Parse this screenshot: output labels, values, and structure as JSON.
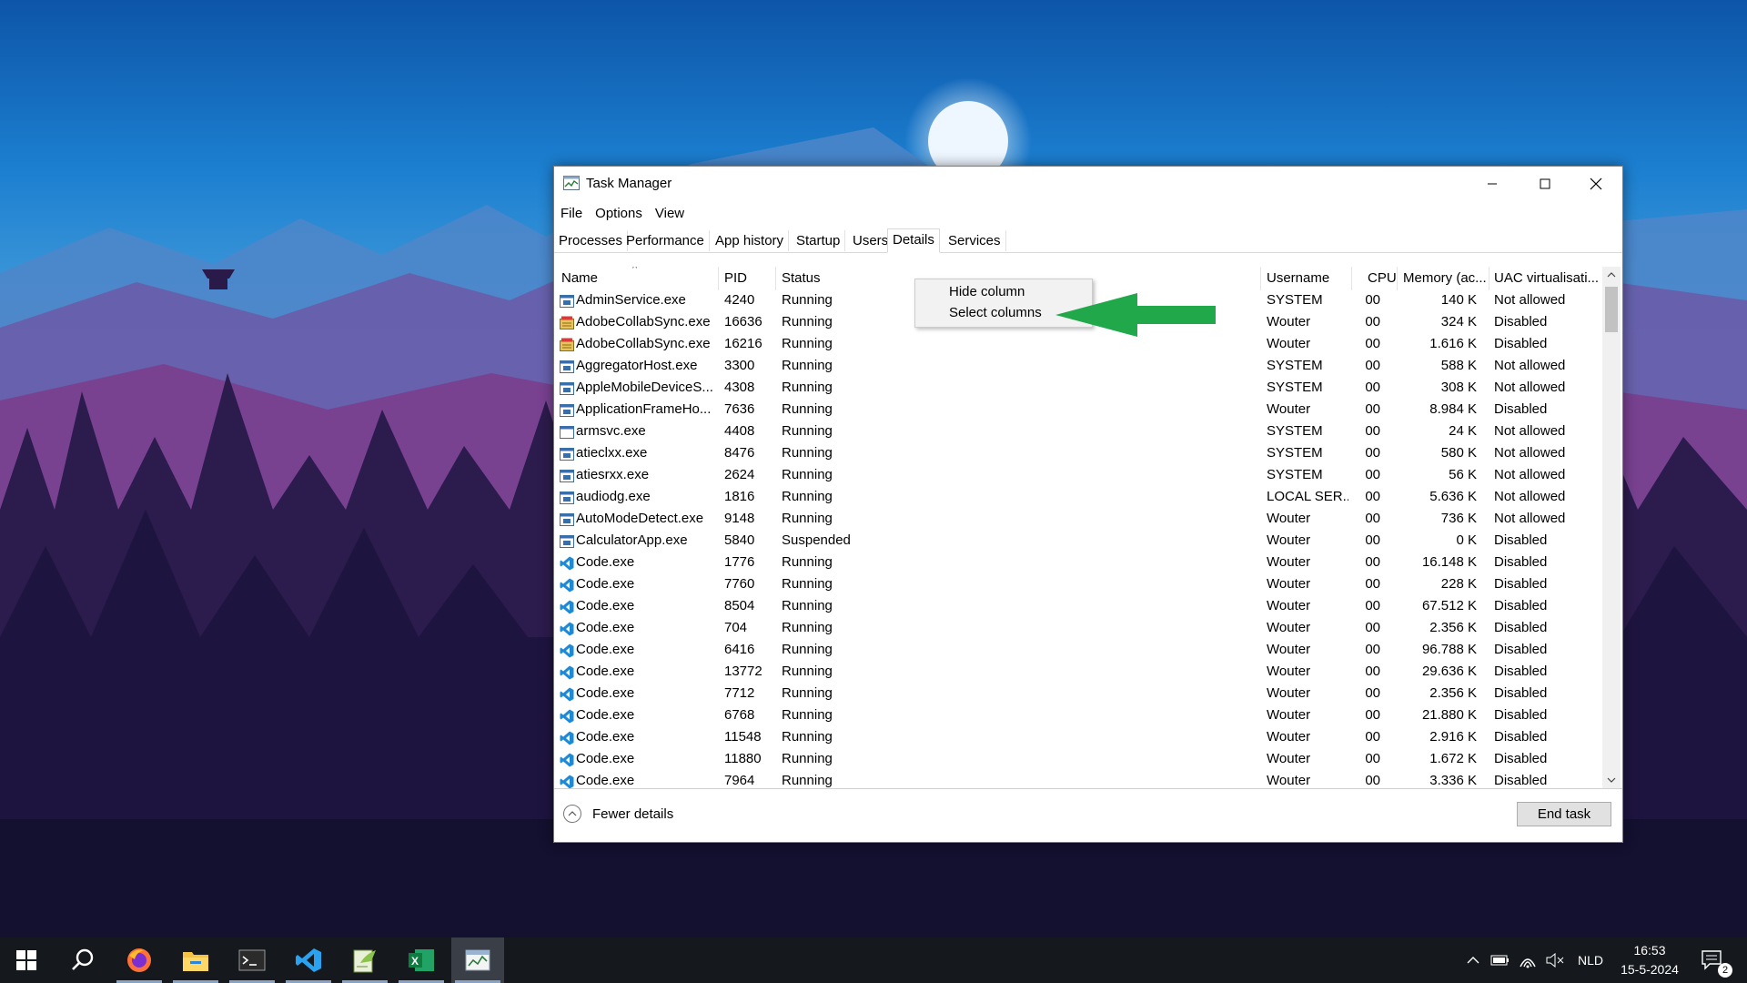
{
  "window": {
    "title": "Task Manager",
    "menu": [
      "File",
      "Options",
      "View"
    ],
    "tabs": [
      "Processes",
      "Performance",
      "App history",
      "Startup",
      "Users",
      "Details",
      "Services"
    ],
    "active_tab": "Details"
  },
  "columns": [
    "Name",
    "PID",
    "Status",
    "Username",
    "CPU",
    "Memory (ac...",
    "UAC virtualisati..."
  ],
  "rows": [
    {
      "name": "AdminService.exe",
      "pid": "4240",
      "status": "Running",
      "user": "SYSTEM",
      "cpu": "00",
      "mem": "140 K",
      "uac": "Not allowed",
      "icon": "service-app-icon"
    },
    {
      "name": "AdobeCollabSync.exe",
      "pid": "16636",
      "status": "Running",
      "user": "Wouter",
      "cpu": "00",
      "mem": "324 K",
      "uac": "Disabled",
      "icon": "adobe-sync-icon"
    },
    {
      "name": "AdobeCollabSync.exe",
      "pid": "16216",
      "status": "Running",
      "user": "Wouter",
      "cpu": "00",
      "mem": "1.616 K",
      "uac": "Disabled",
      "icon": "adobe-sync-icon"
    },
    {
      "name": "AggregatorHost.exe",
      "pid": "3300",
      "status": "Running",
      "user": "SYSTEM",
      "cpu": "00",
      "mem": "588 K",
      "uac": "Not allowed",
      "icon": "service-app-icon"
    },
    {
      "name": "AppleMobileDeviceS...",
      "pid": "4308",
      "status": "Running",
      "user": "SYSTEM",
      "cpu": "00",
      "mem": "308 K",
      "uac": "Not allowed",
      "icon": "service-app-icon"
    },
    {
      "name": "ApplicationFrameHo...",
      "pid": "7636",
      "status": "Running",
      "user": "Wouter",
      "cpu": "00",
      "mem": "8.984 K",
      "uac": "Disabled",
      "icon": "service-app-icon"
    },
    {
      "name": "armsvc.exe",
      "pid": "4408",
      "status": "Running",
      "user": "SYSTEM",
      "cpu": "00",
      "mem": "24 K",
      "uac": "Not allowed",
      "icon": "blank-window-icon"
    },
    {
      "name": "atieclxx.exe",
      "pid": "8476",
      "status": "Running",
      "user": "SYSTEM",
      "cpu": "00",
      "mem": "580 K",
      "uac": "Not allowed",
      "icon": "service-app-icon"
    },
    {
      "name": "atiesrxx.exe",
      "pid": "2624",
      "status": "Running",
      "user": "SYSTEM",
      "cpu": "00",
      "mem": "56 K",
      "uac": "Not allowed",
      "icon": "service-app-icon"
    },
    {
      "name": "audiodg.exe",
      "pid": "1816",
      "status": "Running",
      "user": "LOCAL SER...",
      "cpu": "00",
      "mem": "5.636 K",
      "uac": "Not allowed",
      "icon": "service-app-icon"
    },
    {
      "name": "AutoModeDetect.exe",
      "pid": "9148",
      "status": "Running",
      "user": "Wouter",
      "cpu": "00",
      "mem": "736 K",
      "uac": "Not allowed",
      "icon": "service-app-icon"
    },
    {
      "name": "CalculatorApp.exe",
      "pid": "5840",
      "status": "Suspended",
      "user": "Wouter",
      "cpu": "00",
      "mem": "0 K",
      "uac": "Disabled",
      "icon": "service-app-icon"
    },
    {
      "name": "Code.exe",
      "pid": "1776",
      "status": "Running",
      "user": "Wouter",
      "cpu": "00",
      "mem": "16.148 K",
      "uac": "Disabled",
      "icon": "vscode-icon"
    },
    {
      "name": "Code.exe",
      "pid": "7760",
      "status": "Running",
      "user": "Wouter",
      "cpu": "00",
      "mem": "228 K",
      "uac": "Disabled",
      "icon": "vscode-icon"
    },
    {
      "name": "Code.exe",
      "pid": "8504",
      "status": "Running",
      "user": "Wouter",
      "cpu": "00",
      "mem": "67.512 K",
      "uac": "Disabled",
      "icon": "vscode-icon"
    },
    {
      "name": "Code.exe",
      "pid": "704",
      "status": "Running",
      "user": "Wouter",
      "cpu": "00",
      "mem": "2.356 K",
      "uac": "Disabled",
      "icon": "vscode-icon"
    },
    {
      "name": "Code.exe",
      "pid": "6416",
      "status": "Running",
      "user": "Wouter",
      "cpu": "00",
      "mem": "96.788 K",
      "uac": "Disabled",
      "icon": "vscode-icon"
    },
    {
      "name": "Code.exe",
      "pid": "13772",
      "status": "Running",
      "user": "Wouter",
      "cpu": "00",
      "mem": "29.636 K",
      "uac": "Disabled",
      "icon": "vscode-icon"
    },
    {
      "name": "Code.exe",
      "pid": "7712",
      "status": "Running",
      "user": "Wouter",
      "cpu": "00",
      "mem": "2.356 K",
      "uac": "Disabled",
      "icon": "vscode-icon"
    },
    {
      "name": "Code.exe",
      "pid": "6768",
      "status": "Running",
      "user": "Wouter",
      "cpu": "00",
      "mem": "21.880 K",
      "uac": "Disabled",
      "icon": "vscode-icon"
    },
    {
      "name": "Code.exe",
      "pid": "11548",
      "status": "Running",
      "user": "Wouter",
      "cpu": "00",
      "mem": "2.916 K",
      "uac": "Disabled",
      "icon": "vscode-icon"
    },
    {
      "name": "Code.exe",
      "pid": "11880",
      "status": "Running",
      "user": "Wouter",
      "cpu": "00",
      "mem": "1.672 K",
      "uac": "Disabled",
      "icon": "vscode-icon"
    },
    {
      "name": "Code.exe",
      "pid": "7964",
      "status": "Running",
      "user": "Wouter",
      "cpu": "00",
      "mem": "3.336 K",
      "uac": "Disabled",
      "icon": "vscode-icon"
    }
  ],
  "context_menu": [
    "Hide column",
    "Select columns"
  ],
  "footer": {
    "fewer_details": "Fewer details",
    "end_task": "End task"
  },
  "taskbar": {
    "apps": [
      "start-icon",
      "search-icon",
      "firefox-icon",
      "file-explorer-icon",
      "terminal-icon",
      "vscode-icon",
      "notepad-plus-plus-icon",
      "excel-icon",
      "task-manager-icon"
    ],
    "language": "NLD",
    "time": "16:53",
    "date": "15-5-2024",
    "notification_count": "2"
  },
  "colors": {
    "annotation_arrow": "#21a84a",
    "taskbar": "#15181d",
    "accent": "#0078d7"
  }
}
